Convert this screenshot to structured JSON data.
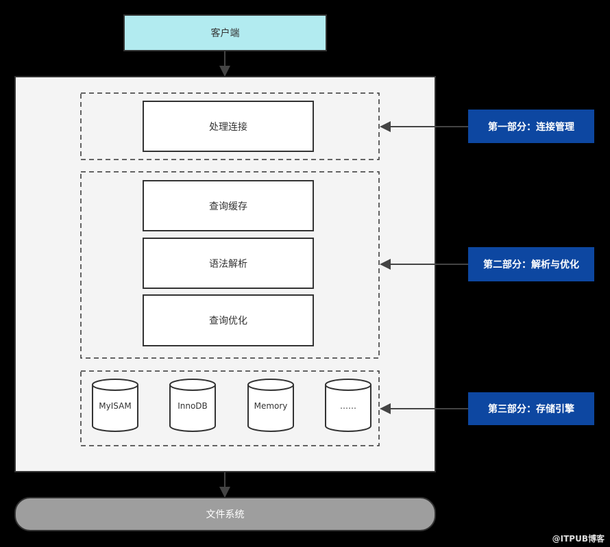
{
  "client": "客户端",
  "groups": {
    "connection": {
      "modules": [
        "处理连接"
      ]
    },
    "parsing": {
      "modules": [
        "查询缓存",
        "语法解析",
        "查询优化"
      ]
    },
    "storage": {
      "engines": [
        "MyISAM",
        "InnoDB",
        "Memory",
        "……"
      ]
    }
  },
  "labels": [
    "第一部分：连接管理",
    "第二部分：解析与优化",
    "第三部分：存储引擎"
  ],
  "filesystem": "文件系统",
  "watermark": "@ITPUB博客",
  "colors": {
    "client_fill": "#b2ebf0",
    "label_fill": "#0d47a1",
    "server_fill": "#f4f4f4",
    "filesystem_fill": "#9e9e9e"
  }
}
